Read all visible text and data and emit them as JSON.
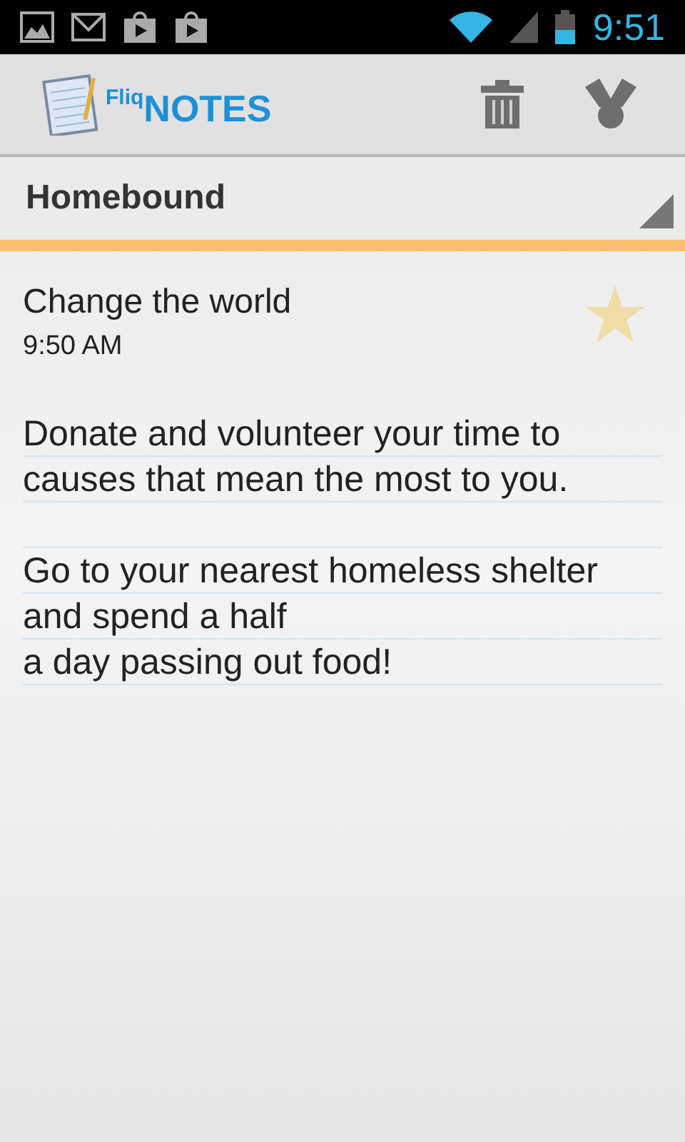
{
  "status_bar": {
    "time": "9:51"
  },
  "app_bar": {
    "logo_small": "Fliq",
    "logo_big": "NOTES"
  },
  "category": {
    "label": "Homebound"
  },
  "note": {
    "title": "Change the world",
    "time": "9:50 AM",
    "starred": false,
    "paragraphs": [
      [
        "Donate and volunteer your time to",
        "causes that mean the most to you."
      ],
      [
        "Go to your nearest homeless shelter",
        "and spend a half",
        "a day passing out food!"
      ]
    ]
  }
}
